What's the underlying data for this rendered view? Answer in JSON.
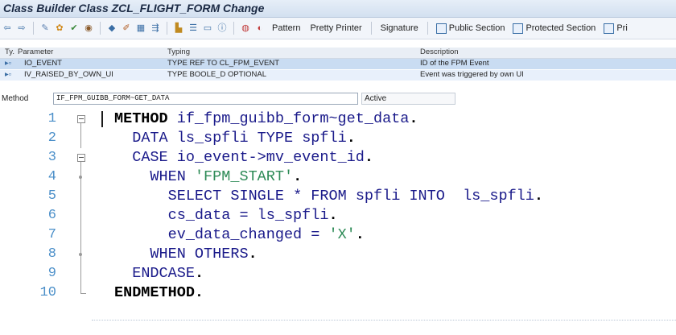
{
  "window": {
    "title": "Class Builder Class ZCL_FLIGHT_FORM Change"
  },
  "toolbar": {
    "nav_icons": [
      "back-arrow-icon",
      "forward-arrow-icon"
    ],
    "tool_icons": [
      "other-object-icon",
      "display-change-icon",
      "check-icon",
      "activate-icon",
      "test-icon",
      "where-used-icon",
      "edit-icon",
      "navigate-icon",
      "hierarchy-icon",
      "info-icon",
      "help-icon",
      "pattern-icon",
      "insert-icon"
    ],
    "pattern_label": "Pattern",
    "pretty_printer_label": "Pretty Printer",
    "signature_label": "Signature",
    "public_section_label": "Public Section",
    "protected_section_label": "Protected Section",
    "private_section_label_cut": "Pri"
  },
  "params": {
    "headers": {
      "type": "Ty.",
      "parameter": "Parameter",
      "typing": "Typing",
      "description": "Description"
    },
    "rows": [
      {
        "parameter": "IO_EVENT",
        "typing": "TYPE REF TO CL_FPM_EVENT",
        "description": "ID of the FPM Event"
      },
      {
        "parameter": "IV_RAISED_BY_OWN_UI",
        "typing": "TYPE BOOLE_D OPTIONAL",
        "description": "Event was triggered by own UI"
      }
    ]
  },
  "method": {
    "label": "Method",
    "value": "IF_FPM_GUIBB_FORM~GET_DATA",
    "status": "Active"
  },
  "editor": {
    "line_numbers": [
      "1",
      "2",
      "3",
      "4",
      "5",
      "6",
      "7",
      "8",
      "9",
      "10"
    ],
    "lines": [
      {
        "indent": "",
        "tokens": [
          {
            "t": "METHOD",
            "c": "bk"
          },
          {
            "t": " if_fpm_guibb_form~get_data",
            "c": "id"
          },
          {
            "t": ".",
            "c": "bk"
          }
        ]
      },
      {
        "indent": "  ",
        "tokens": [
          {
            "t": "DATA",
            "c": "kw"
          },
          {
            "t": " ls_spfli ",
            "c": "id"
          },
          {
            "t": "TYPE",
            "c": "kw"
          },
          {
            "t": " spfli",
            "c": "id"
          },
          {
            "t": ".",
            "c": "bk"
          }
        ]
      },
      {
        "indent": "  ",
        "tokens": [
          {
            "t": "CASE",
            "c": "kw"
          },
          {
            "t": " io_event->mv_event_id",
            "c": "id"
          },
          {
            "t": ".",
            "c": "bk"
          }
        ]
      },
      {
        "indent": "    ",
        "tokens": [
          {
            "t": "WHEN",
            "c": "kw"
          },
          {
            "t": " ",
            "c": "id"
          },
          {
            "t": "'FPM_START'",
            "c": "str"
          },
          {
            "t": ".",
            "c": "bk"
          }
        ]
      },
      {
        "indent": "      ",
        "tokens": [
          {
            "t": "SELECT",
            "c": "kw"
          },
          {
            "t": " ",
            "c": "id"
          },
          {
            "t": "SINGLE",
            "c": "kw"
          },
          {
            "t": " * ",
            "c": "id"
          },
          {
            "t": "FROM",
            "c": "kw"
          },
          {
            "t": " spfli ",
            "c": "id"
          },
          {
            "t": "INTO",
            "c": "kw"
          },
          {
            "t": "  ls_spfli",
            "c": "id"
          },
          {
            "t": ".",
            "c": "bk"
          }
        ]
      },
      {
        "indent": "      ",
        "tokens": [
          {
            "t": "cs_data = ls_spfli",
            "c": "id"
          },
          {
            "t": ".",
            "c": "bk"
          }
        ]
      },
      {
        "indent": "      ",
        "tokens": [
          {
            "t": "ev_data_changed = ",
            "c": "id"
          },
          {
            "t": "'X'",
            "c": "str"
          },
          {
            "t": ".",
            "c": "bk"
          }
        ]
      },
      {
        "indent": "    ",
        "tokens": [
          {
            "t": "WHEN OTHERS",
            "c": "kw"
          },
          {
            "t": ".",
            "c": "bk"
          }
        ]
      },
      {
        "indent": "  ",
        "tokens": [
          {
            "t": "ENDCASE",
            "c": "kw"
          },
          {
            "t": ".",
            "c": "bk"
          }
        ]
      },
      {
        "indent": "",
        "tokens": [
          {
            "t": "ENDMETHOD",
            "c": "bk"
          },
          {
            "t": ".",
            "c": "bk"
          }
        ]
      }
    ],
    "fold_markers": [
      "box",
      "none",
      "box",
      "dot",
      "line",
      "line",
      "line",
      "dot",
      "line",
      "end"
    ]
  },
  "colors": {
    "keyword": "#1a1a8a",
    "string": "#2e8b57",
    "line_number": "#4b8fc9",
    "selected_row": "#c9dcf2"
  }
}
